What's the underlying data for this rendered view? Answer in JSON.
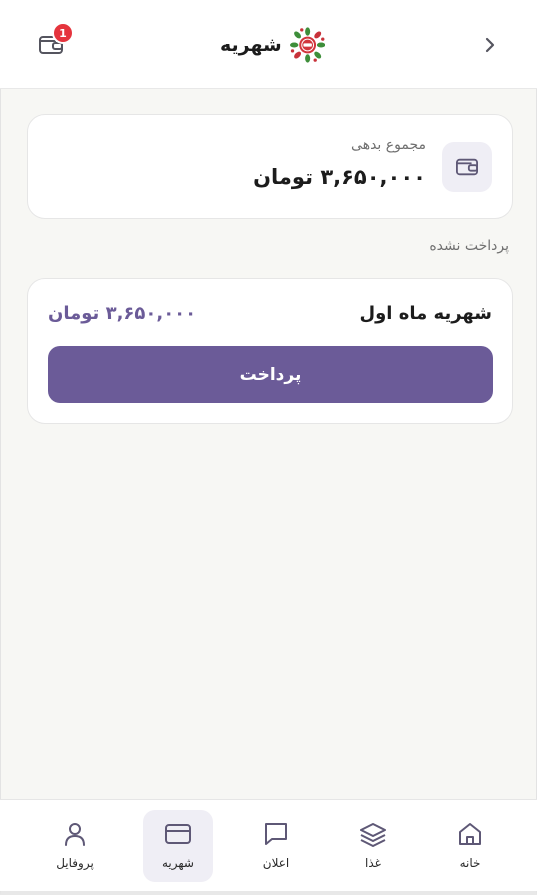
{
  "header": {
    "title": "شهریه",
    "back_icon": "chevron-right-icon",
    "wallet_icon": "wallet-icon",
    "notification_count": "1"
  },
  "summary": {
    "label": "مجموع بدهی",
    "amount": "۳,۶۵۰,۰۰۰ تومان",
    "icon": "wallet-icon"
  },
  "section": {
    "label": "پرداخت نشده"
  },
  "invoice": {
    "title": "شهریه ماه اول",
    "amount": "۳,۶۵۰,۰۰۰ تومان",
    "pay_label": "پرداخت"
  },
  "nav": {
    "items": [
      {
        "label": "خانه",
        "icon": "home-icon"
      },
      {
        "label": "غذا",
        "icon": "layers-icon"
      },
      {
        "label": "اعلان",
        "icon": "message-icon"
      },
      {
        "label": "شهریه",
        "icon": "card-icon",
        "active": true
      },
      {
        "label": "پروفایل",
        "icon": "user-icon"
      }
    ]
  },
  "colors": {
    "accent": "#6b5b98",
    "badge": "#e5343d",
    "active_bg": "#efeef5",
    "background": "#f7f7f4"
  }
}
